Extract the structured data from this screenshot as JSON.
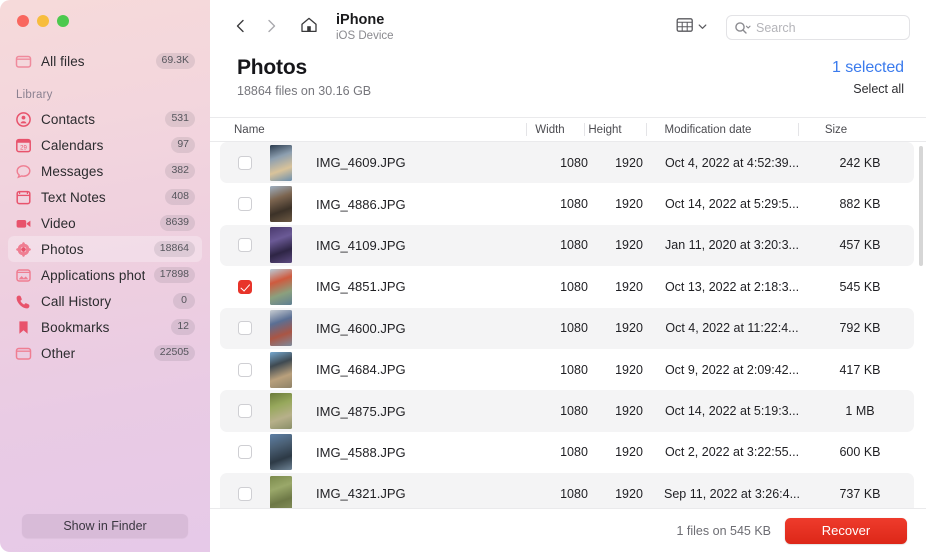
{
  "window": {
    "traffic_lights": [
      "close",
      "minimize",
      "zoom"
    ],
    "colors": {
      "accent_blue": "#3b7bed",
      "recover_red": "#e8342a",
      "sidebar_pink": "#f6dada",
      "sidebar_lavender": "#e6c9e8",
      "alt_row": "#f4f4f5"
    }
  },
  "sidebar": {
    "all_files": {
      "label": "All files",
      "badge": "69.3K",
      "icon": "folder-icon"
    },
    "section_label": "Library",
    "items": [
      {
        "label": "Contacts",
        "badge": "531",
        "icon": "contacts-icon"
      },
      {
        "label": "Calendars",
        "badge": "97",
        "icon": "calendar-icon"
      },
      {
        "label": "Messages",
        "badge": "382",
        "icon": "message-bubble-icon"
      },
      {
        "label": "Text Notes",
        "badge": "408",
        "icon": "notes-icon"
      },
      {
        "label": "Video",
        "badge": "8639",
        "icon": "video-camera-icon"
      },
      {
        "label": "Photos",
        "badge": "18864",
        "icon": "photos-flower-icon",
        "active": true
      },
      {
        "label": "Applications photo",
        "badge": "17898",
        "icon": "app-photo-icon"
      },
      {
        "label": "Call History",
        "badge": "0",
        "icon": "phone-icon"
      },
      {
        "label": "Bookmarks",
        "badge": "12",
        "icon": "bookmark-icon"
      },
      {
        "label": "Other",
        "badge": "22505",
        "icon": "folder-icon"
      }
    ],
    "show_in_finder_label": "Show in Finder"
  },
  "toolbar": {
    "back_icon": "chevron-left-icon",
    "forward_icon": "chevron-right-icon",
    "home_icon": "home-icon",
    "device_name": "iPhone",
    "device_subtitle": "iOS Device",
    "view_icon": "grid-view-icon",
    "view_chevron_icon": "chevron-down-icon",
    "search_icon": "search-icon",
    "search_placeholder": "Search",
    "search_value": ""
  },
  "header": {
    "title": "Photos",
    "subtitle": "18864 files on 30.16 GB",
    "selected_label": "1 selected",
    "select_all_label": "Select all"
  },
  "table": {
    "columns": [
      "Name",
      "Width",
      "Height",
      "Modification date",
      "Size"
    ],
    "rows": [
      {
        "name": "IMG_4609.JPG",
        "width": "1080",
        "height": "1920",
        "date": "Oct 4, 2022 at 4:52:39...",
        "size": "242 KB",
        "checked": false,
        "thumb": [
          "#2b3b4e",
          "#8d9fb0",
          "#d9c39a",
          "#6b8fae"
        ]
      },
      {
        "name": "IMG_4886.JPG",
        "width": "1080",
        "height": "1920",
        "date": "Oct 14, 2022 at 5:29:5...",
        "size": "882 KB",
        "checked": false,
        "thumb": [
          "#9fb0c2",
          "#7c6550",
          "#3c3228",
          "#6d5a44"
        ]
      },
      {
        "name": "IMG_4109.JPG",
        "width": "1080",
        "height": "1920",
        "date": "Jan 11, 2020 at 3:20:3...",
        "size": "457 KB",
        "checked": false,
        "thumb": [
          "#4a3a6e",
          "#6b5a96",
          "#2e2545",
          "#5c4a80"
        ]
      },
      {
        "name": "IMG_4851.JPG",
        "width": "1080",
        "height": "1920",
        "date": "Oct 13, 2022 at 2:18:3...",
        "size": "545 KB",
        "checked": true,
        "thumb": [
          "#b9ccd8",
          "#cf5a3e",
          "#8ba07e",
          "#5f7f93"
        ]
      },
      {
        "name": "IMG_4600.JPG",
        "width": "1080",
        "height": "1920",
        "date": "Oct 4, 2022 at 11:22:4...",
        "size": "792 KB",
        "checked": false,
        "thumb": [
          "#c8cdd2",
          "#5a6f94",
          "#aa5544",
          "#7e8b9c"
        ]
      },
      {
        "name": "IMG_4684.JPG",
        "width": "1080",
        "height": "1920",
        "date": "Oct 9, 2022 at 2:09:42...",
        "size": "417 KB",
        "checked": false,
        "thumb": [
          "#76a8cf",
          "#3f4a52",
          "#b9a07c",
          "#8f8267"
        ]
      },
      {
        "name": "IMG_4875.JPG",
        "width": "1080",
        "height": "1920",
        "date": "Oct 14, 2022 at 5:19:3...",
        "size": "1 MB",
        "checked": false,
        "thumb": [
          "#6b7a3a",
          "#97a85c",
          "#b7b08a",
          "#8a8f68"
        ]
      },
      {
        "name": "IMG_4588.JPG",
        "width": "1080",
        "height": "1920",
        "date": "Oct 2, 2022 at 3:22:55...",
        "size": "600 KB",
        "checked": false,
        "thumb": [
          "#5d7fa5",
          "#4a5f74",
          "#2d3a46",
          "#6f8496"
        ]
      },
      {
        "name": "IMG_4321.JPG",
        "width": "1080",
        "height": "1920",
        "date": "Sep 11, 2022 at 3:26:4...",
        "size": "737 KB",
        "checked": false,
        "thumb": [
          "#7b8a4c",
          "#9aa86a",
          "#6d7846",
          "#88925e"
        ]
      }
    ]
  },
  "footer": {
    "status": "1 files on 545 KB",
    "recover_label": "Recover"
  }
}
